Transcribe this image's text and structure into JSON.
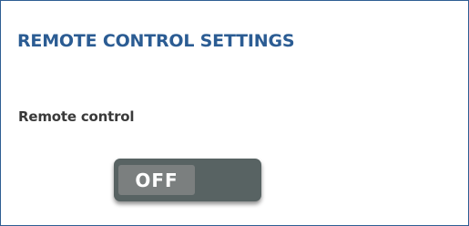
{
  "settings": {
    "title": "REMOTE CONTROL SETTINGS",
    "remote_control": {
      "label": "Remote control",
      "toggle_state": "OFF",
      "enabled": false
    }
  },
  "colors": {
    "title": "#2b5c93",
    "border": "#2f5e93",
    "toggle_track": "#586363",
    "toggle_knob": "#7b7f7f"
  }
}
